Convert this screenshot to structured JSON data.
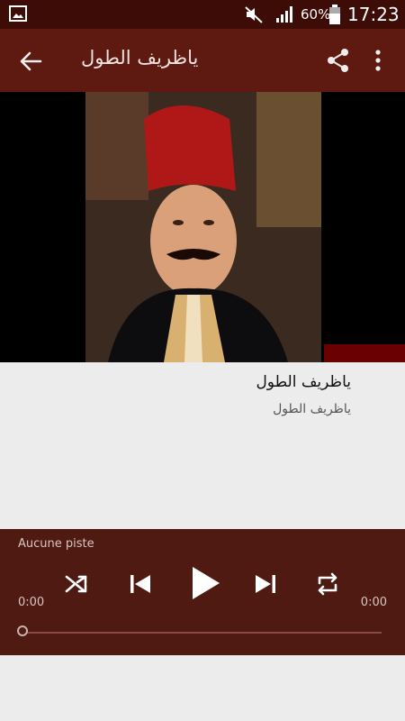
{
  "status": {
    "battery_percent": "60%",
    "time": "17:23",
    "icons": [
      "gallery-icon",
      "mute-icon",
      "signal-icon",
      "battery-icon"
    ]
  },
  "appbar": {
    "title": "ياظريف الطول",
    "icons": [
      "back-arrow-icon",
      "share-icon",
      "more-vert-icon"
    ]
  },
  "song": {
    "title": "ياظريف الطول",
    "subtitle": "ياظريف الطول"
  },
  "player": {
    "track_label": "Aucune piste",
    "elapsed": "0:00",
    "duration": "0:00",
    "progress": 0,
    "icons": [
      "shuffle-icon",
      "skip-previous-icon",
      "play-icon",
      "skip-next-icon",
      "repeat-icon"
    ]
  },
  "colors": {
    "statusbar": "#3e0c07",
    "appbar": "#5e1a10",
    "player": "#4e1a12",
    "background": "#ececec"
  }
}
